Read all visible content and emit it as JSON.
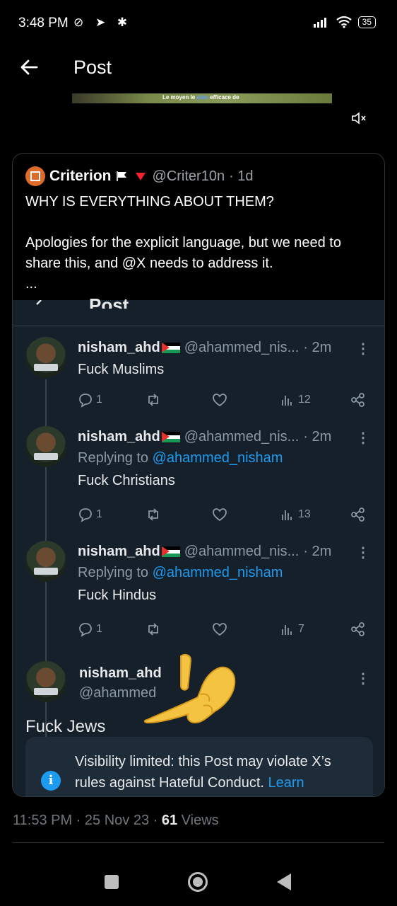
{
  "status_bar": {
    "time": "3:48 PM",
    "icons": "⊘ ➤ ✱",
    "signal": "📶",
    "wifi": "📶",
    "battery": "35"
  },
  "header": {
    "title": "Post"
  },
  "video": {
    "caption_pre": "Le moyen le ",
    "caption_hl": "plus",
    "caption_post": " efficace de"
  },
  "quote": {
    "name": "Criterion",
    "handle": "@Criter10n",
    "time": "· 1d",
    "line1": "WHY IS EVERYTHING ABOUT THEM?",
    "line2": "Apologies for the explicit language, but we need to share this, and @X needs to address it.",
    "ellipsis": "..."
  },
  "embed": {
    "title": "Post",
    "tweets": [
      {
        "name": "nisham_ahd",
        "handle": "@ahammed_nis...",
        "time": "· 2m",
        "text": "Fuck Muslims",
        "reply": "",
        "comments": "1",
        "views": "12"
      },
      {
        "name": "nisham_ahd",
        "handle": "@ahammed_nis...",
        "time": "· 2m",
        "reply_pre": "Replying to ",
        "reply_mention": "@ahammed_nisham",
        "text": "Fuck Christians",
        "comments": "1",
        "views": "13"
      },
      {
        "name": "nisham_ahd",
        "handle": "@ahammed_nis...",
        "time": "· 2m",
        "reply_pre": "Replying to ",
        "reply_mention": "@ahammed_nisham",
        "text": "Fuck Hindus",
        "comments": "1",
        "views": "7"
      }
    ],
    "last_name": "nisham_ahd",
    "last_handle": "@ahammed",
    "big_text": "Fuck Jews",
    "notice_text": "Visibility limited: this Post may violate X’s rules against Hateful Conduct.",
    "notice_link": "Learn"
  },
  "footer": {
    "time_date": "11:53 PM · 25 Nov 23 · ",
    "views_count": "61",
    "views_label": " Views"
  },
  "icons": {
    "more": "⋮"
  }
}
